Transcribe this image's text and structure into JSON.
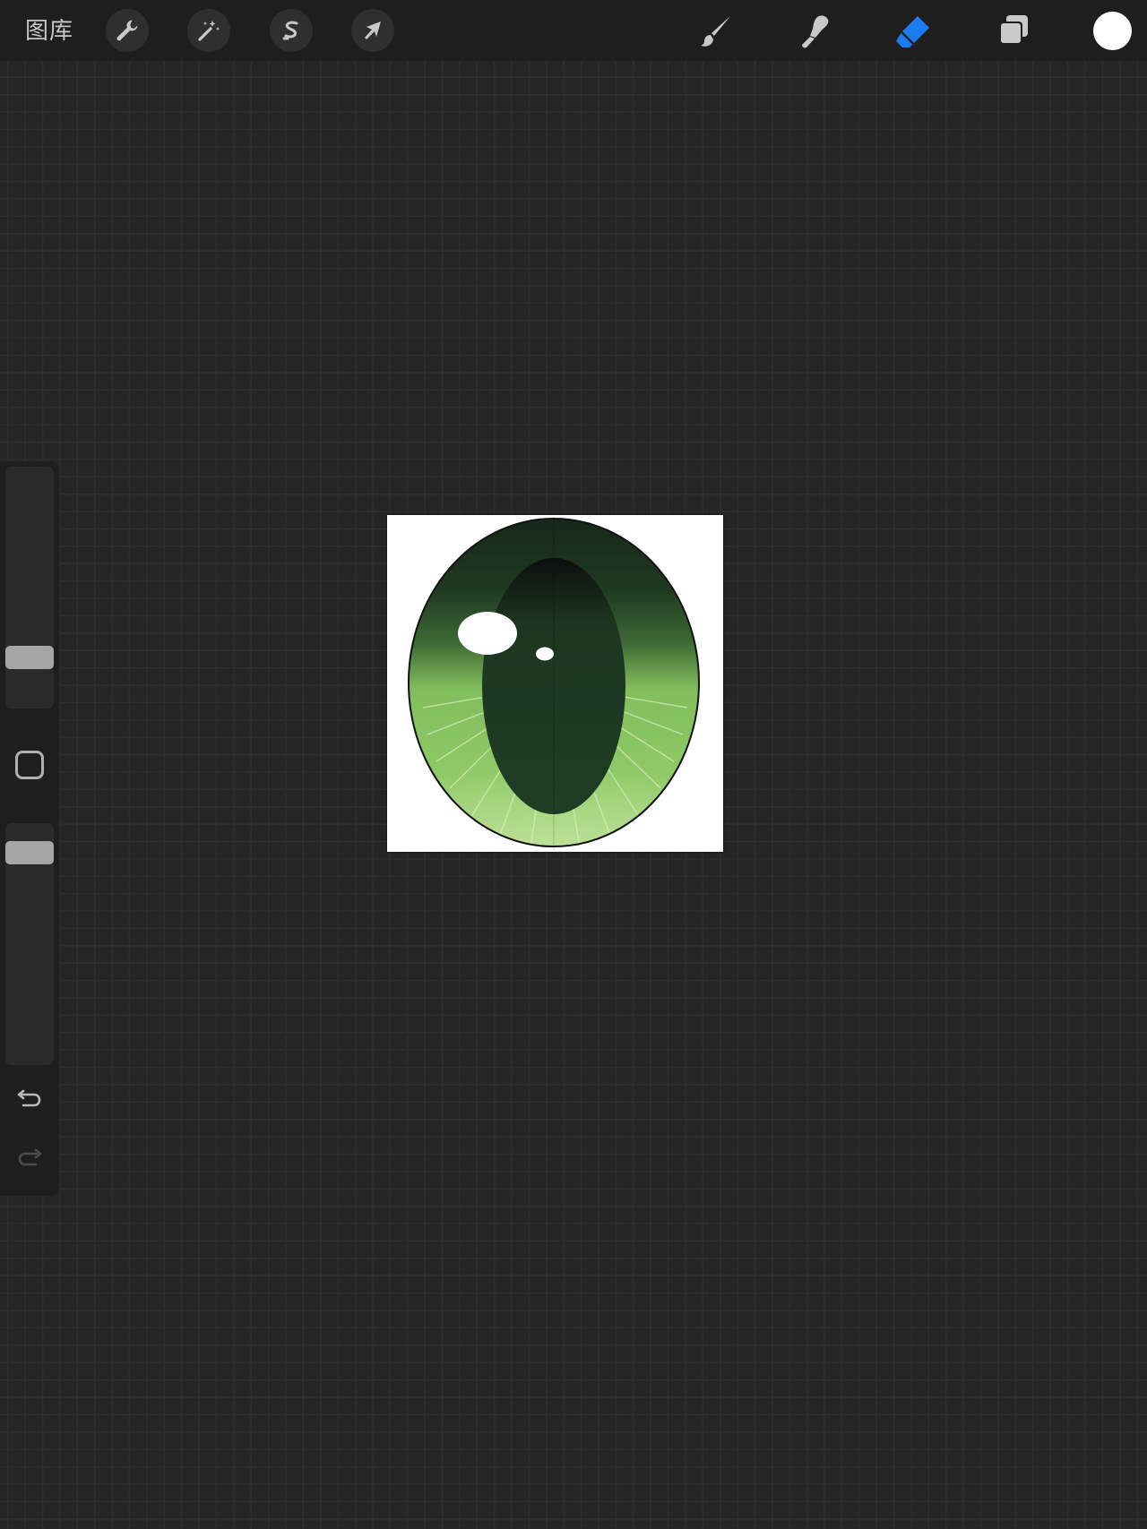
{
  "toolbar": {
    "gallery_label": "图库",
    "left_tools": [
      {
        "name": "actions",
        "icon": "wrench-icon"
      },
      {
        "name": "adjustments",
        "icon": "magic-wand-icon"
      },
      {
        "name": "selection",
        "icon": "selection-s-icon"
      },
      {
        "name": "transform",
        "icon": "arrow-cursor-icon"
      }
    ],
    "right_tools": [
      {
        "name": "brush",
        "icon": "brush-icon",
        "active": false
      },
      {
        "name": "smudge",
        "icon": "smudge-icon",
        "active": false
      },
      {
        "name": "eraser",
        "icon": "eraser-icon",
        "active": true
      },
      {
        "name": "layers",
        "icon": "layers-icon",
        "active": false
      }
    ],
    "current_color": "#ffffff",
    "accent_color": "#1a7cf0"
  },
  "sidebar": {
    "brush_size_level": 0.18,
    "opacity_level": 0.92,
    "modify_button_icon": "square-icon",
    "undo_icon": "undo-icon",
    "redo_icon": "redo-icon"
  },
  "canvas": {
    "artwork": "green-cat-eye",
    "iris_light_color": "#8cc964",
    "iris_dark_color": "#1f3a22",
    "pupil_color": "#1f3d24"
  }
}
